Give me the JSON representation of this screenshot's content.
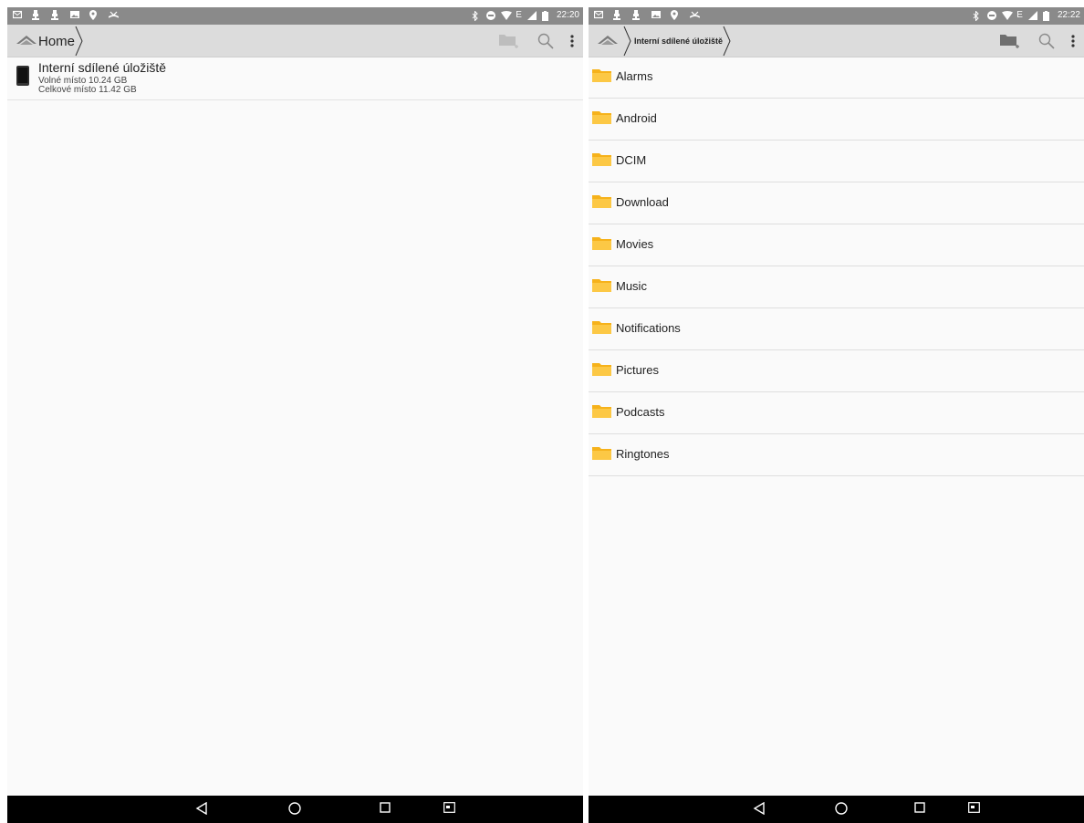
{
  "left": {
    "status_time": "22:20",
    "status_network": "E",
    "breadcrumb": {
      "home_label": "Home"
    },
    "storage": {
      "title": "Interní sdílené úložiště",
      "free": "Volné místo 10.24 GB",
      "total": "Celkové místo 11.42 GB"
    }
  },
  "right": {
    "status_time": "22:22",
    "status_network": "E",
    "breadcrumb": {
      "current": "Interní sdílené úložiště"
    },
    "folders": [
      "Alarms",
      "Android",
      "DCIM",
      "Download",
      "Movies",
      "Music",
      "Notifications",
      "Pictures",
      "Podcasts",
      "Ringtones"
    ]
  },
  "icons": {
    "status_left": [
      "email-icon",
      "usb-icon",
      "usb-icon",
      "image-icon",
      "location-icon",
      "missed-call-icon"
    ],
    "status_right": [
      "bluetooth-icon",
      "do-not-disturb-icon",
      "wifi-icon",
      "signal-icon",
      "battery-icon"
    ],
    "toolbar": [
      "new-folder-icon",
      "search-icon",
      "more-icon"
    ],
    "navbar": [
      "back-icon",
      "home-icon",
      "recents-icon",
      "screenshot-icon"
    ]
  },
  "colors": {
    "folder": "#f6b21b",
    "statusbar": "#8a8a8a",
    "actionbar": "#dcdcdc"
  }
}
